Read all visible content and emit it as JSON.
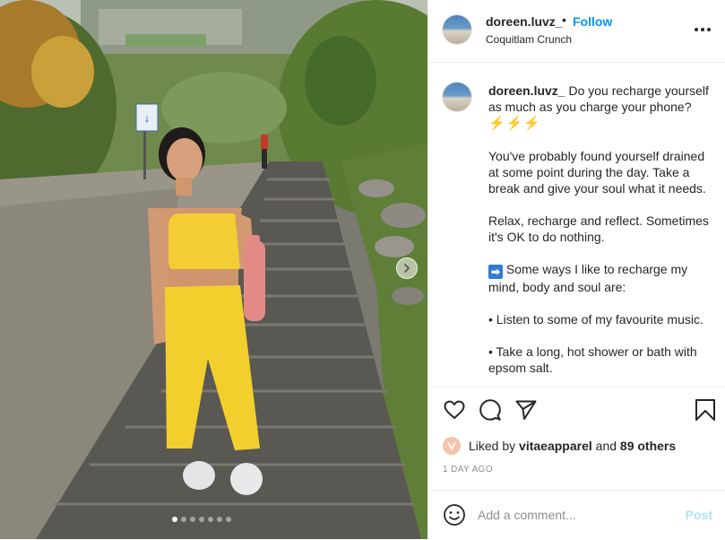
{
  "post": {
    "username": "doreen.luvz_",
    "separator": "•",
    "follow_label": "Follow",
    "location": "Coquitlam Crunch",
    "more_icon": "more-horizontal-icon",
    "photo_sign": "↓",
    "carousel": {
      "count": 7,
      "active_index": 0
    }
  },
  "caption": {
    "username": "doreen.luvz_",
    "intro": " Do you recharge yourself as much as you charge your phone?",
    "bolts": "⚡⚡⚡",
    "p1": "You've probably found yourself drained at some point during the day. Take a break and give your soul what it needs.",
    "p2": "Relax, recharge and reflect. Sometimes it's OK to do nothing.",
    "p3_icon": "➡",
    "p3": " Some ways I like to recharge my mind, body and soul are:",
    "p4": "• Listen to some of my favourite music.",
    "p5": "• Take a long, hot shower or bath with epsom salt."
  },
  "likes": {
    "prefix": "Liked by ",
    "user": "vitaeapparel",
    "mid": " and ",
    "others": "89 others"
  },
  "date": "1 DAY AGO",
  "comment": {
    "placeholder": "Add a comment...",
    "post_label": "Post"
  },
  "colors": {
    "link_blue": "#0095f6",
    "post_disabled": "#b2dffc",
    "text": "#262626",
    "muted": "#8e8e8e",
    "outfit_yellow": "#f5d33c"
  }
}
